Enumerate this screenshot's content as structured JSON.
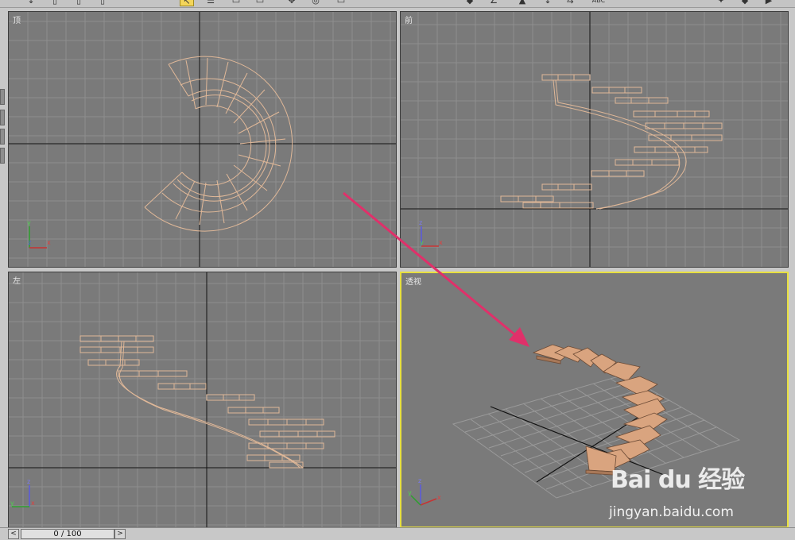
{
  "viewports": {
    "top": {
      "label": "顶"
    },
    "front": {
      "label": "前"
    },
    "left": {
      "label": "左"
    },
    "perspective": {
      "label": "透视"
    }
  },
  "axes": {
    "x": "x",
    "y": "y",
    "z": "z"
  },
  "toolbar": {
    "abc_label": "ABC"
  },
  "status": {
    "frame": "0 / 100",
    "prev": "<",
    "next": ">"
  },
  "watermark": {
    "logo": "Bai du 经验",
    "url": "jingyan.baidu.com"
  },
  "colors": {
    "viewport_bg": "#7a7a7a",
    "stair_wire": "#e0b898",
    "active_border": "#e8e040",
    "arrow": "#e0306a",
    "stair_solid": "#d9a47f"
  }
}
